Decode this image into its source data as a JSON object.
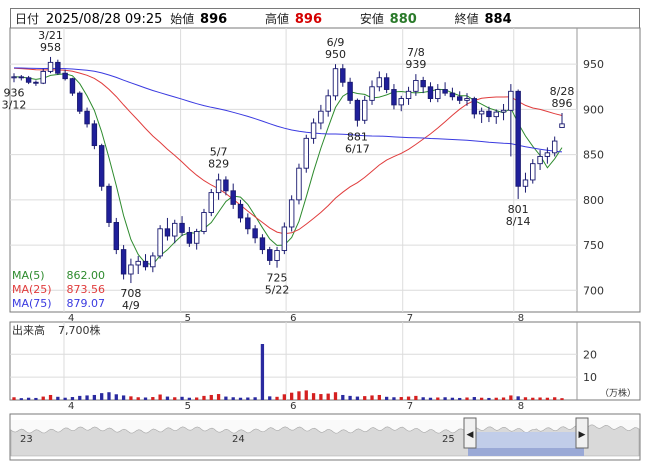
{
  "header": {
    "date_label": "日付",
    "datetime": "2025/08/28 09:25",
    "open_label": "始値",
    "open": "896",
    "high_label": "高値",
    "high": "896",
    "low_label": "安値",
    "low": "880",
    "close_label": "終値",
    "close": "884",
    "colors": {
      "high": "#d40000",
      "low": "#2a7a2a",
      "open": "#111111",
      "close": "#111111"
    }
  },
  "chart_data": [
    {
      "type": "candlestick",
      "x_ticks": [
        "4",
        "5",
        "6",
        "7",
        "8"
      ],
      "y_ticks": [
        "950",
        "900",
        "850",
        "800",
        "750",
        "700"
      ],
      "ylim": [
        676,
        990
      ],
      "candles": [
        [
          936,
          940,
          930,
          936
        ],
        [
          936,
          938,
          932,
          935
        ],
        [
          935,
          937,
          928,
          930
        ],
        [
          930,
          932,
          926,
          929
        ],
        [
          929,
          945,
          928,
          942
        ],
        [
          942,
          958,
          940,
          952
        ],
        [
          952,
          955,
          938,
          940
        ],
        [
          940,
          944,
          932,
          934
        ],
        [
          934,
          935,
          915,
          918
        ],
        [
          918,
          920,
          895,
          898
        ],
        [
          898,
          902,
          880,
          884
        ],
        [
          884,
          888,
          856,
          860
        ],
        [
          860,
          862,
          810,
          815
        ],
        [
          815,
          818,
          770,
          775
        ],
        [
          775,
          780,
          740,
          745
        ],
        [
          745,
          750,
          712,
          718
        ],
        [
          718,
          735,
          708,
          728
        ],
        [
          728,
          738,
          718,
          732
        ],
        [
          732,
          740,
          722,
          726
        ],
        [
          726,
          742,
          720,
          738
        ],
        [
          738,
          772,
          735,
          768
        ],
        [
          768,
          780,
          755,
          760
        ],
        [
          760,
          778,
          752,
          774
        ],
        [
          774,
          782,
          760,
          764
        ],
        [
          764,
          770,
          748,
          752
        ],
        [
          752,
          768,
          745,
          765
        ],
        [
          765,
          790,
          762,
          786
        ],
        [
          786,
          812,
          782,
          808
        ],
        [
          808,
          829,
          800,
          822
        ],
        [
          822,
          826,
          805,
          810
        ],
        [
          810,
          818,
          790,
          795
        ],
        [
          795,
          800,
          775,
          780
        ],
        [
          780,
          785,
          762,
          768
        ],
        [
          768,
          772,
          752,
          758
        ],
        [
          758,
          762,
          740,
          745
        ],
        [
          745,
          748,
          728,
          733
        ],
        [
          733,
          748,
          725,
          744
        ],
        [
          744,
          775,
          740,
          770
        ],
        [
          770,
          805,
          765,
          800
        ],
        [
          800,
          840,
          795,
          835
        ],
        [
          835,
          872,
          830,
          868
        ],
        [
          868,
          890,
          862,
          885
        ],
        [
          885,
          905,
          878,
          898
        ],
        [
          898,
          922,
          892,
          915
        ],
        [
          915,
          950,
          910,
          945
        ],
        [
          945,
          950,
          925,
          930
        ],
        [
          930,
          935,
          906,
          910
        ],
        [
          910,
          912,
          881,
          888
        ],
        [
          888,
          915,
          884,
          910
        ],
        [
          910,
          932,
          905,
          925
        ],
        [
          925,
          942,
          920,
          935
        ],
        [
          935,
          940,
          918,
          922
        ],
        [
          922,
          928,
          900,
          905
        ],
        [
          905,
          915,
          898,
          912
        ],
        [
          912,
          925,
          905,
          920
        ],
        [
          920,
          939,
          915,
          932
        ],
        [
          932,
          936,
          918,
          925
        ],
        [
          925,
          930,
          908,
          912
        ],
        [
          912,
          928,
          908,
          922
        ],
        [
          922,
          930,
          915,
          918
        ],
        [
          918,
          924,
          910,
          914
        ],
        [
          914,
          920,
          906,
          910
        ],
        [
          910,
          918,
          904,
          912
        ],
        [
          912,
          914,
          890,
          895
        ],
        [
          895,
          902,
          885,
          898
        ],
        [
          898,
          903,
          886,
          892
        ],
        [
          892,
          900,
          884,
          897
        ],
        [
          897,
          906,
          888,
          899
        ],
        [
          899,
          928,
          848,
          920
        ],
        [
          920,
          922,
          801,
          815
        ],
        [
          815,
          830,
          808,
          822
        ],
        [
          822,
          845,
          818,
          840
        ],
        [
          840,
          855,
          833,
          848
        ],
        [
          848,
          858,
          840,
          852
        ],
        [
          852,
          870,
          848,
          865
        ],
        [
          880,
          896,
          880,
          884
        ]
      ],
      "ma": [
        {
          "name": "MA(5)",
          "value": "862.00",
          "color": "#2e8b2e"
        },
        {
          "name": "MA(25)",
          "value": "873.56",
          "color": "#e03c3c"
        },
        {
          "name": "MA(75)",
          "value": "879.07",
          "color": "#3a3ae0"
        }
      ],
      "annotations": [
        {
          "date": "3/21",
          "value": "958",
          "i": 5,
          "pos": "above"
        },
        {
          "date": "3/12",
          "value": "936",
          "i": 0,
          "pos": "below"
        },
        {
          "date": "5/7",
          "value": "829",
          "i": 28,
          "pos": "above"
        },
        {
          "date": "4/9",
          "value": "708",
          "i": 16,
          "pos": "below"
        },
        {
          "date": "5/22",
          "value": "725",
          "i": 36,
          "pos": "below"
        },
        {
          "date": "6/9",
          "value": "950",
          "i": 44,
          "pos": "above"
        },
        {
          "date": "6/17",
          "value": "881",
          "i": 47,
          "pos": "below"
        },
        {
          "date": "7/8",
          "value": "939",
          "i": 55,
          "pos": "above"
        },
        {
          "date": "8/14",
          "value": "801",
          "i": 69,
          "pos": "below"
        },
        {
          "date": "8/28",
          "value": "896",
          "i": 75,
          "pos": "above"
        }
      ]
    },
    {
      "type": "bar",
      "label": "出来高",
      "latest_volume": "7,700株",
      "unit": "（万株）",
      "y_ticks": [
        "20",
        "10"
      ],
      "ylim": [
        0,
        28
      ],
      "values": [
        1.2,
        0.8,
        1.0,
        0.9,
        1.5,
        2.2,
        1.4,
        1.0,
        1.3,
        1.8,
        2.0,
        2.2,
        3.0,
        3.4,
        2.5,
        2.0,
        1.6,
        1.2,
        1.1,
        1.3,
        2.4,
        1.5,
        1.2,
        1.4,
        1.0,
        1.1,
        1.8,
        2.2,
        2.6,
        1.5,
        1.2,
        1.0,
        1.1,
        1.2,
        1.3,
        1.6,
        1.4,
        2.5,
        3.2,
        3.8,
        4.2,
        3.0,
        2.6,
        2.8,
        3.4,
        2.2,
        1.8,
        1.5,
        1.7,
        2.0,
        2.2,
        1.4,
        1.2,
        1.3,
        1.5,
        1.8,
        1.2,
        1.0,
        1.1,
        1.2,
        1.0,
        0.9,
        1.1,
        1.3,
        1.0,
        0.9,
        1.0,
        1.1,
        2.0,
        1.6,
        1.2,
        1.0,
        1.1,
        1.0,
        1.2,
        0.8
      ],
      "spike": {
        "i": 34,
        "value": 24.5
      },
      "colors": {
        "up": "#d42020",
        "down": "#2a2aa0"
      }
    }
  ],
  "scrollbar": {
    "labels": [
      "23",
      "24",
      "25"
    ],
    "left_handle": "◀",
    "right_handle": "▶"
  }
}
